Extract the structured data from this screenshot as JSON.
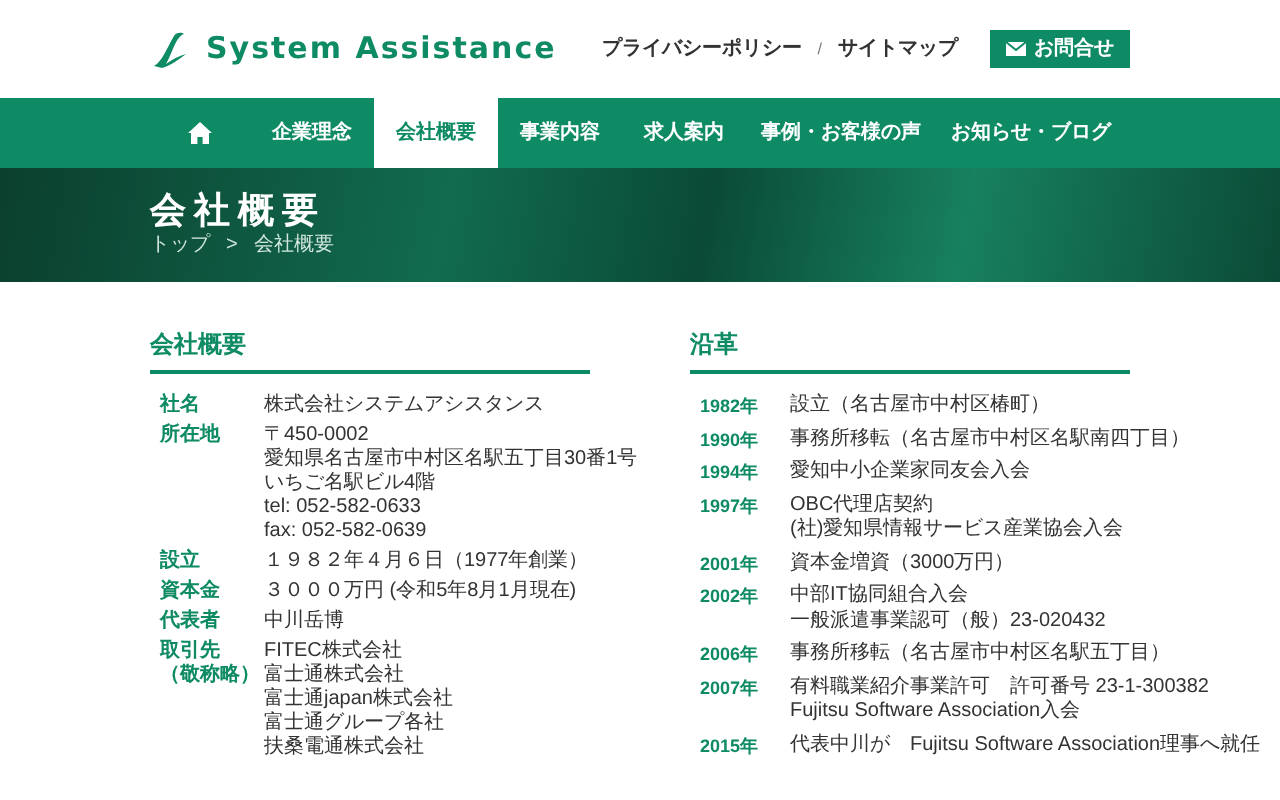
{
  "header": {
    "logo_text": "System Assistance",
    "links": [
      "プライバシーポリシー",
      "サイトマップ"
    ],
    "separator": "/",
    "contact_button": "お問合せ"
  },
  "nav": [
    {
      "kind": "home",
      "selected": false
    },
    {
      "label": "企業理念",
      "selected": false
    },
    {
      "label": "会社概要",
      "selected": true
    },
    {
      "label": "事業内容",
      "selected": false
    },
    {
      "label": "求人案内",
      "selected": false
    },
    {
      "label": "事例・お客様の声",
      "selected": false
    },
    {
      "label": "お知らせ・ブログ",
      "selected": false
    }
  ],
  "hero": {
    "title": "会社概要",
    "breadcrumb": [
      "トップ",
      "会社概要"
    ],
    "breadcrumb_separator": ">"
  },
  "company": {
    "heading": "会社概要",
    "rows": [
      {
        "label": [
          "社名"
        ],
        "value": [
          "株式会社システムアシスタンス"
        ]
      },
      {
        "label": [
          "所在地"
        ],
        "value": [
          "〒450-0002",
          "愛知県名古屋市中村区名駅五丁目30番1号",
          "いちご名駅ビル4階",
          "tel: 052-582-0633",
          "fax: 052-582-0639"
        ]
      },
      {
        "label": [
          "設立"
        ],
        "value": [
          "１９８２年４月６日（1977年創業）"
        ]
      },
      {
        "label": [
          "資本金"
        ],
        "value": [
          "３０００万円 (令和5年8月1月現在)"
        ]
      },
      {
        "label": [
          "代表者"
        ],
        "value": [
          "中川岳博"
        ]
      },
      {
        "label": [
          "取引先",
          "（敬称略）"
        ],
        "value": [
          "FITEC株式会社",
          "富士通株式会社",
          "富士通japan株式会社",
          "富士通グループ各社",
          "扶桑電通株式会社"
        ]
      }
    ]
  },
  "history": {
    "heading": "沿革",
    "rows": [
      {
        "year": "1982年",
        "events": [
          "設立（名古屋市中村区椿町）"
        ]
      },
      {
        "year": "1990年",
        "events": [
          "事務所移転（名古屋市中村区名駅南四丁目）"
        ]
      },
      {
        "year": "1994年",
        "events": [
          "愛知中小企業家同友会入会"
        ]
      },
      {
        "year": "1997年",
        "events": [
          "OBC代理店契約",
          "(社)愛知県情報サービス産業協会入会"
        ]
      },
      {
        "year": "2001年",
        "events": [
          "資本金増資（3000万円）"
        ]
      },
      {
        "year": "2002年",
        "events": [
          "中部IT協同組合入会",
          "一般派遣事業認可（般）23-020432"
        ]
      },
      {
        "year": "2006年",
        "events": [
          "事務所移転（名古屋市中村区名駅五丁目）"
        ]
      },
      {
        "year": "2007年",
        "events": [
          "有料職業紹介事業許可　許可番号 23-1-300382",
          "Fujitsu Software Association入会"
        ]
      },
      {
        "year": "2015年",
        "events": [
          "代表中川が　Fujitsu Software Association理事へ就任"
        ]
      }
    ]
  }
}
